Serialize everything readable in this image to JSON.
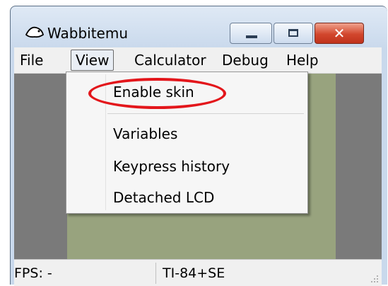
{
  "window": {
    "title": "Wabbitemu"
  },
  "menubar": {
    "items": [
      "File",
      "View",
      "Calculator",
      "Debug",
      "Help"
    ]
  },
  "view_menu": {
    "items": [
      "Enable skin",
      "Variables",
      "Keypress history",
      "Detached LCD"
    ]
  },
  "statusbar": {
    "fps": "FPS: -",
    "model": "TI-84+SE"
  },
  "colors": {
    "highlight_ring": "#e3161b",
    "lcd": "#98a37e",
    "close_button": "#d2472d"
  },
  "icons": [
    "app-icon",
    "minimize-icon",
    "maximize-icon",
    "close-icon",
    "resize-grip-icon"
  ]
}
